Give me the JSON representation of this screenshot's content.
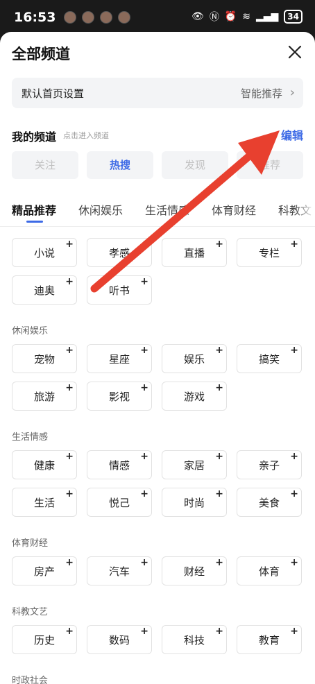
{
  "status_bar": {
    "time": "16:53",
    "battery": "34"
  },
  "sheet": {
    "title": "全部频道",
    "default_page": {
      "label": "默认首页设置",
      "value": "智能推荐"
    },
    "my_channels": {
      "title": "我的频道",
      "hint": "点击进入频道",
      "edit_label": "编辑",
      "items": [
        "关注",
        "热搜",
        "发现",
        "推荐"
      ]
    },
    "tabs": [
      "精品推荐",
      "休闲娱乐",
      "生活情感",
      "体育财经",
      "科教文"
    ],
    "sections": [
      {
        "title": "",
        "items": [
          "小说",
          "孝感",
          "直播",
          "专栏",
          "迪奥",
          "听书"
        ]
      },
      {
        "title": "休闲娱乐",
        "items": [
          "宠物",
          "星座",
          "娱乐",
          "搞笑",
          "旅游",
          "影视",
          "游戏"
        ]
      },
      {
        "title": "生活情感",
        "items": [
          "健康",
          "情感",
          "家居",
          "亲子",
          "生活",
          "悦己",
          "时尚",
          "美食"
        ]
      },
      {
        "title": "体育财经",
        "items": [
          "房产",
          "汽车",
          "财经",
          "体育"
        ]
      },
      {
        "title": "科教文艺",
        "items": [
          "历史",
          "数码",
          "科技",
          "教育"
        ]
      },
      {
        "title": "时政社会",
        "items": []
      }
    ],
    "plus_symbol": "+"
  },
  "colors": {
    "accent": "#3d6ae6",
    "arrow": "#e8402f"
  }
}
